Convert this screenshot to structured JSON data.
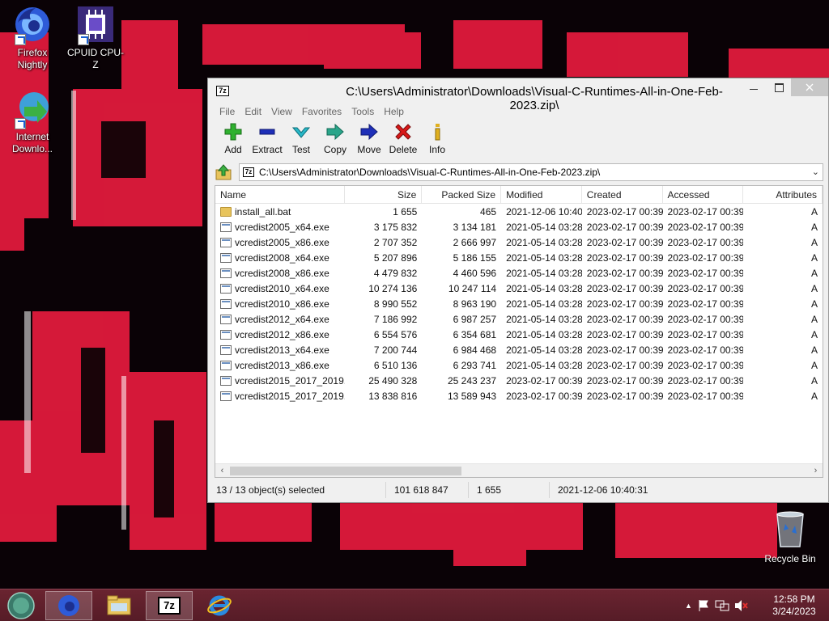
{
  "desktop": {
    "icons": [
      {
        "label": "Firefox Nightly",
        "icon": "firefox-nightly-icon"
      },
      {
        "label": "CPUID CPU-Z",
        "icon": "cpuz-icon"
      },
      {
        "label": "Internet Downlo...",
        "icon": "internet-download-manager-icon"
      }
    ],
    "recycle_bin": "Recycle Bin"
  },
  "window": {
    "title": "C:\\Users\\Administrator\\Downloads\\Visual-C-Runtimes-All-in-One-Feb-2023.zip\\",
    "app_icon_text": "7z",
    "menu": [
      "File",
      "Edit",
      "View",
      "Favorites",
      "Tools",
      "Help"
    ],
    "toolbar": [
      {
        "label": "Add",
        "icon": "plus-icon"
      },
      {
        "label": "Extract",
        "icon": "minus-icon"
      },
      {
        "label": "Test",
        "icon": "check-icon"
      },
      {
        "label": "Copy",
        "icon": "copy-arrow-icon"
      },
      {
        "label": "Move",
        "icon": "move-arrow-icon"
      },
      {
        "label": "Delete",
        "icon": "delete-x-icon"
      },
      {
        "label": "Info",
        "icon": "info-icon"
      }
    ],
    "address": "C:\\Users\\Administrator\\Downloads\\Visual-C-Runtimes-All-in-One-Feb-2023.zip\\",
    "columns": [
      "Name",
      "Size",
      "Packed Size",
      "Modified",
      "Created",
      "Accessed",
      "Attributes"
    ],
    "files": [
      {
        "name": "install_all.bat",
        "size": "1 655",
        "packed": "465",
        "modified": "2021-12-06 10:40",
        "created": "2023-02-17 00:39",
        "accessed": "2023-02-17 00:39",
        "attr": "A",
        "type": "bat"
      },
      {
        "name": "vcredist2005_x64.exe",
        "size": "3 175 832",
        "packed": "3 134 181",
        "modified": "2021-05-14 03:28",
        "created": "2023-02-17 00:39",
        "accessed": "2023-02-17 00:39",
        "attr": "A",
        "type": "exe"
      },
      {
        "name": "vcredist2005_x86.exe",
        "size": "2 707 352",
        "packed": "2 666 997",
        "modified": "2021-05-14 03:28",
        "created": "2023-02-17 00:39",
        "accessed": "2023-02-17 00:39",
        "attr": "A",
        "type": "exe"
      },
      {
        "name": "vcredist2008_x64.exe",
        "size": "5 207 896",
        "packed": "5 186 155",
        "modified": "2021-05-14 03:28",
        "created": "2023-02-17 00:39",
        "accessed": "2023-02-17 00:39",
        "attr": "A",
        "type": "exe"
      },
      {
        "name": "vcredist2008_x86.exe",
        "size": "4 479 832",
        "packed": "4 460 596",
        "modified": "2021-05-14 03:28",
        "created": "2023-02-17 00:39",
        "accessed": "2023-02-17 00:39",
        "attr": "A",
        "type": "exe"
      },
      {
        "name": "vcredist2010_x64.exe",
        "size": "10 274 136",
        "packed": "10 247 114",
        "modified": "2021-05-14 03:28",
        "created": "2023-02-17 00:39",
        "accessed": "2023-02-17 00:39",
        "attr": "A",
        "type": "exe"
      },
      {
        "name": "vcredist2010_x86.exe",
        "size": "8 990 552",
        "packed": "8 963 190",
        "modified": "2021-05-14 03:28",
        "created": "2023-02-17 00:39",
        "accessed": "2023-02-17 00:39",
        "attr": "A",
        "type": "exe"
      },
      {
        "name": "vcredist2012_x64.exe",
        "size": "7 186 992",
        "packed": "6 987 257",
        "modified": "2021-05-14 03:28",
        "created": "2023-02-17 00:39",
        "accessed": "2023-02-17 00:39",
        "attr": "A",
        "type": "exe"
      },
      {
        "name": "vcredist2012_x86.exe",
        "size": "6 554 576",
        "packed": "6 354 681",
        "modified": "2021-05-14 03:28",
        "created": "2023-02-17 00:39",
        "accessed": "2023-02-17 00:39",
        "attr": "A",
        "type": "exe"
      },
      {
        "name": "vcredist2013_x64.exe",
        "size": "7 200 744",
        "packed": "6 984 468",
        "modified": "2021-05-14 03:28",
        "created": "2023-02-17 00:39",
        "accessed": "2023-02-17 00:39",
        "attr": "A",
        "type": "exe"
      },
      {
        "name": "vcredist2013_x86.exe",
        "size": "6 510 136",
        "packed": "6 293 741",
        "modified": "2021-05-14 03:28",
        "created": "2023-02-17 00:39",
        "accessed": "2023-02-17 00:39",
        "attr": "A",
        "type": "exe"
      },
      {
        "name": "vcredist2015_2017_2019...",
        "size": "25 490 328",
        "packed": "25 243 237",
        "modified": "2023-02-17 00:39",
        "created": "2023-02-17 00:39",
        "accessed": "2023-02-17 00:39",
        "attr": "A",
        "type": "exe"
      },
      {
        "name": "vcredist2015_2017_2019...",
        "size": "13 838 816",
        "packed": "13 589 943",
        "modified": "2023-02-17 00:39",
        "created": "2023-02-17 00:39",
        "accessed": "2023-02-17 00:39",
        "attr": "A",
        "type": "exe"
      }
    ],
    "status": {
      "selection": "13 / 13 object(s) selected",
      "total_size": "101 618 847",
      "packed_size": "1 655",
      "date": "2021-12-06 10:40:31"
    }
  },
  "taskbar": {
    "apps": [
      "start-orb-icon",
      "firefox-nightly-icon",
      "file-explorer-icon",
      "7zip-icon",
      "internet-explorer-icon"
    ],
    "seven_zip_label": "7z",
    "time": "12:58 PM",
    "date": "3/24/2023"
  },
  "colors": {
    "wallpaper_dark": "#0a0206",
    "wallpaper_red": "#e01a3c",
    "taskbar": "#5e1f2b",
    "close_button": "#c7c7c7"
  }
}
